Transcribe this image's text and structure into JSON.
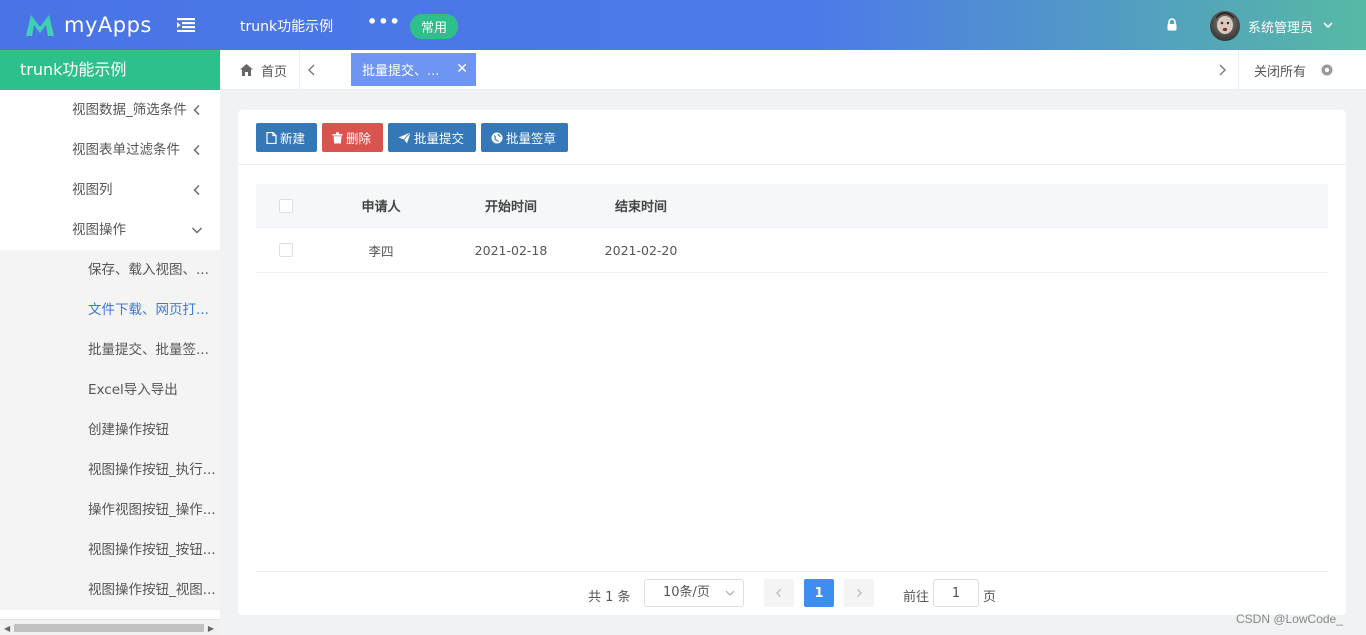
{
  "topbar": {
    "logo_text": "myApps",
    "app_name": "trunk功能示例",
    "more": "•••",
    "tag": "常用",
    "user_name": "系统管理员"
  },
  "sidebar": {
    "header": "trunk功能示例",
    "items": [
      {
        "label": "视图数据_筛选条件",
        "chevron": "left"
      },
      {
        "label": "视图表单过滤条件",
        "chevron": "left"
      },
      {
        "label": "视图列",
        "chevron": "left"
      },
      {
        "label": "视图操作",
        "chevron": "down"
      }
    ],
    "sub_items": [
      {
        "label": "保存、载入视图、..."
      },
      {
        "label": "文件下载、网页打..."
      },
      {
        "label": "批量提交、批量签..."
      },
      {
        "label": "Excel导入导出"
      },
      {
        "label": "创建操作按钮"
      },
      {
        "label": "视图操作按钮_执行..."
      },
      {
        "label": "操作视图按钮_操作..."
      },
      {
        "label": "视图操作按钮_按钮..."
      },
      {
        "label": "视图操作按钮_视图..."
      }
    ],
    "active_sub_index": 1
  },
  "tabs": {
    "home": "首页",
    "active": "批量提交、...",
    "close_all": "关闭所有"
  },
  "toolbar": {
    "new": "新建",
    "delete": "删除",
    "batch_submit": "批量提交",
    "batch_sign": "批量签章"
  },
  "table": {
    "headers": [
      "申请人",
      "开始时间",
      "结束时间"
    ],
    "rows": [
      {
        "applicant": "李四",
        "start": "2021-02-18",
        "end": "2021-02-20"
      }
    ]
  },
  "pager": {
    "total": "共 1 条",
    "page_size": "10条/页",
    "current": "1",
    "goto_label": "前往",
    "goto_value": "1",
    "page_suffix": "页"
  },
  "watermark": "CSDN @LowCode_",
  "colors": {
    "accent_green": "#2ec08a",
    "primary_blue": "#3478b8",
    "danger_red": "#d9534f",
    "active_tab": "#6e95f2",
    "page_current": "#3d8ef0"
  }
}
